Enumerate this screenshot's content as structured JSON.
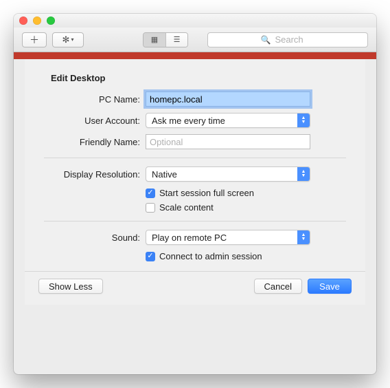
{
  "toolbar": {
    "search_placeholder": "Search"
  },
  "heading": "Edit Desktop",
  "labels": {
    "pc_name": "PC Name:",
    "user_account": "User Account:",
    "friendly_name": "Friendly Name:",
    "display_resolution": "Display Resolution:",
    "sound": "Sound:"
  },
  "values": {
    "pc_name": "homepc.local",
    "user_account": "Ask me every time",
    "friendly_placeholder": "Optional",
    "display_resolution": "Native",
    "sound": "Play on remote PC"
  },
  "checkboxes": {
    "full_screen": "Start session full screen",
    "scale_content": "Scale content",
    "admin_session": "Connect to admin session"
  },
  "buttons": {
    "show_less": "Show Less",
    "cancel": "Cancel",
    "save": "Save"
  }
}
